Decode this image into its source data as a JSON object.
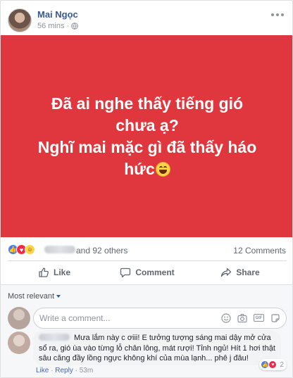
{
  "post": {
    "author": "Mai Ngọc",
    "time": "56 mins",
    "separator": "·",
    "text_line1": "Đã ai nghe thấy tiếng gió chưa ạ?",
    "text_line2": "Nghĩ mai mặc gì đã thấy háo hức",
    "background_color": "#e0363d"
  },
  "reactions": {
    "others": "and 92 others",
    "comments_count": "12 Comments"
  },
  "actions": {
    "like": "Like",
    "comment": "Comment",
    "share": "Share"
  },
  "comments": {
    "sort_label": "Most relevant",
    "input_placeholder": "Write a comment...",
    "gif_label": "GIF",
    "items": [
      {
        "text": "Mưa lắm này c ơiii! E tưởng tượng sáng mai dậy mở cửa sổ ra, gió ùa vào từng lỗ chân lông, mát rượi! Tỉnh ngủ! Hít 1 hơi thật sâu căng đầy lồng ngực không khí của mùa lạnh... phê j đâu!",
        "reaction_count": "2",
        "like_label": "Like",
        "reply_label": "Reply",
        "time": "53m",
        "separator": "·"
      }
    ]
  },
  "colors": {
    "link_blue": "#365899",
    "like_blue": "#4a7cf0",
    "love_red": "#f0284a",
    "haha_yellow": "#ffd545"
  }
}
